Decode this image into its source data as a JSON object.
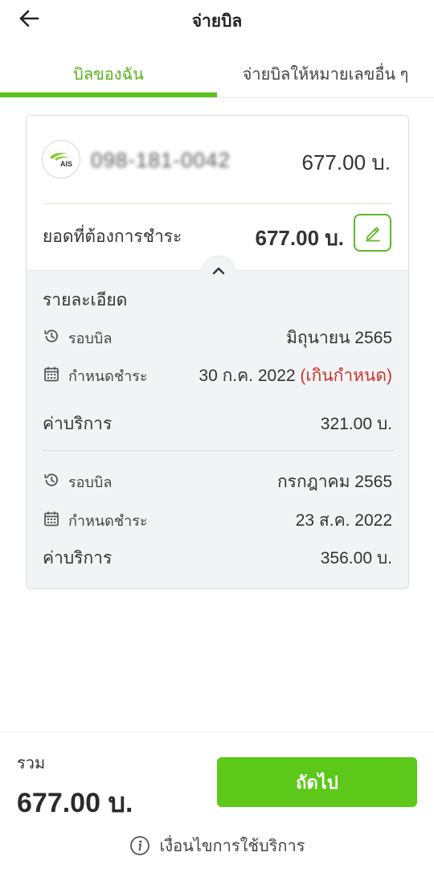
{
  "header": {
    "title": "จ่ายบิล",
    "back_icon": "arrow-left-icon"
  },
  "tabs": [
    {
      "label": "บิลของฉัน",
      "active": true
    },
    {
      "label": "จ่ายบิลให้หมายเลขอื่น ๆ",
      "active": false
    }
  ],
  "colors": {
    "accent": "#5cc21d",
    "overdue": "#c9352a",
    "details_bg": "#f2f3f5"
  },
  "bill": {
    "provider_logo_text": "AIS",
    "masked_number": "098-181-0042",
    "amount": "677.00 บ.",
    "pay_label": "ยอดที่ต้องการชำระ",
    "pay_amount": "677.00 บ."
  },
  "details": {
    "title": "รายละเอียด",
    "entries": [
      {
        "cycle_label": "รอบบิล",
        "cycle_value": "มิถุนายน 2565",
        "due_label": "กำหนดชำระ",
        "due_value": "30 ก.ค. 2022",
        "due_note": "(เกินกำหนด)",
        "fee_label": "ค่าบริการ",
        "fee_value": "321.00 บ."
      },
      {
        "cycle_label": "รอบบิล",
        "cycle_value": "กรกฎาคม 2565",
        "due_label": "กำหนดชำระ",
        "due_value": "23 ส.ค. 2022",
        "fee_label": "ค่าบริการ",
        "fee_value": "356.00 บ."
      }
    ]
  },
  "footer": {
    "total_label": "รวม",
    "total_amount": "677.00 บ.",
    "next_label": "ถัดไป",
    "terms_label": "เงื่อนไขการใช้บริการ"
  }
}
